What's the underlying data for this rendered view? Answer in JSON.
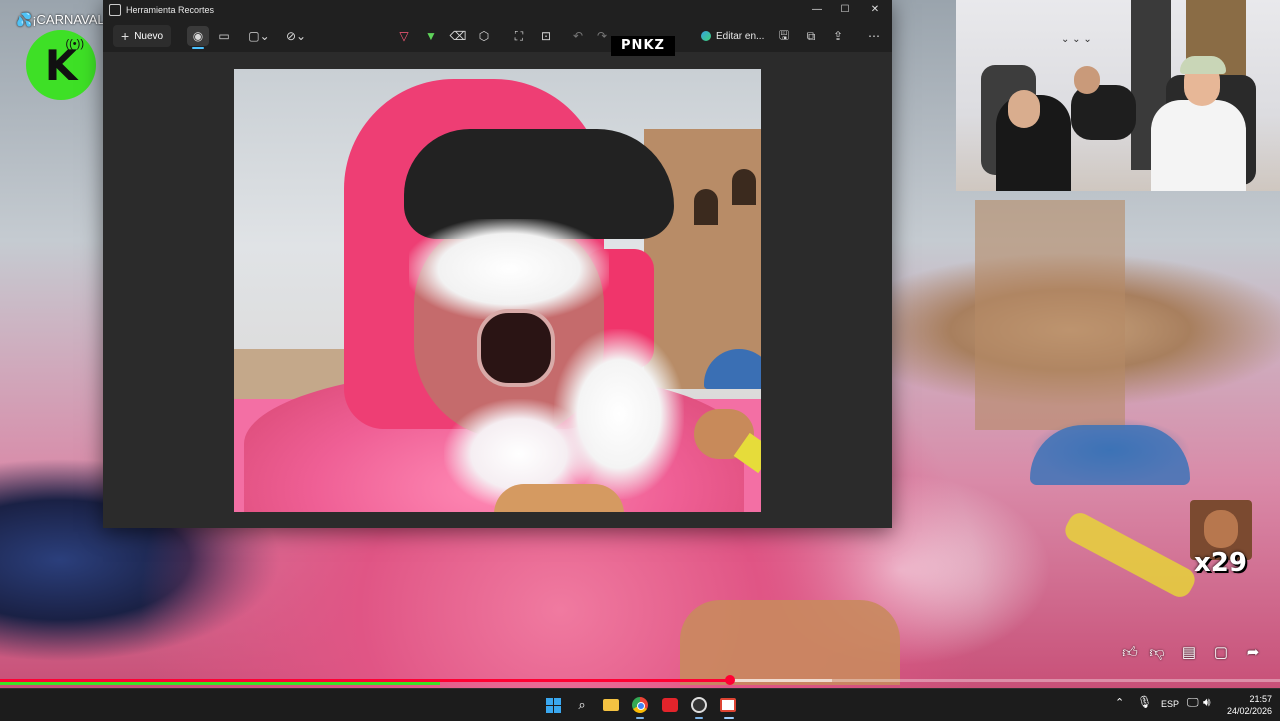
{
  "overlay": {
    "channel_text": "¡CARNAVAL",
    "logo_letter": "K",
    "pnkz_badge": "PNKZ",
    "emote_count": "x29"
  },
  "snipping_tool": {
    "title": "Herramienta Recortes",
    "new_button": "Nuevo",
    "edit_in_button": "Editar en..."
  },
  "video": {
    "progress_percent": 57,
    "buffer_percent": 65
  },
  "taskbar": {
    "language": "ESP",
    "time": "21:57",
    "date": "24/02/2026"
  },
  "colors": {
    "accent": "#4cc2ff",
    "progress": "#ff0033",
    "logo_green": "#3ee026"
  },
  "icons": [
    "camera-icon",
    "video-icon",
    "rectangle-mode-icon",
    "timer-off-icon",
    "pen-icon",
    "highlighter-icon",
    "eraser-icon",
    "shapes-icon",
    "crop-icon",
    "text-actions-icon",
    "undo-icon",
    "redo-icon",
    "edge-icon",
    "save-icon",
    "copy-icon",
    "share-icon",
    "more-icon",
    "like-icon",
    "dislike-icon",
    "comment-icon",
    "comments-icon",
    "share-arrow-icon"
  ]
}
